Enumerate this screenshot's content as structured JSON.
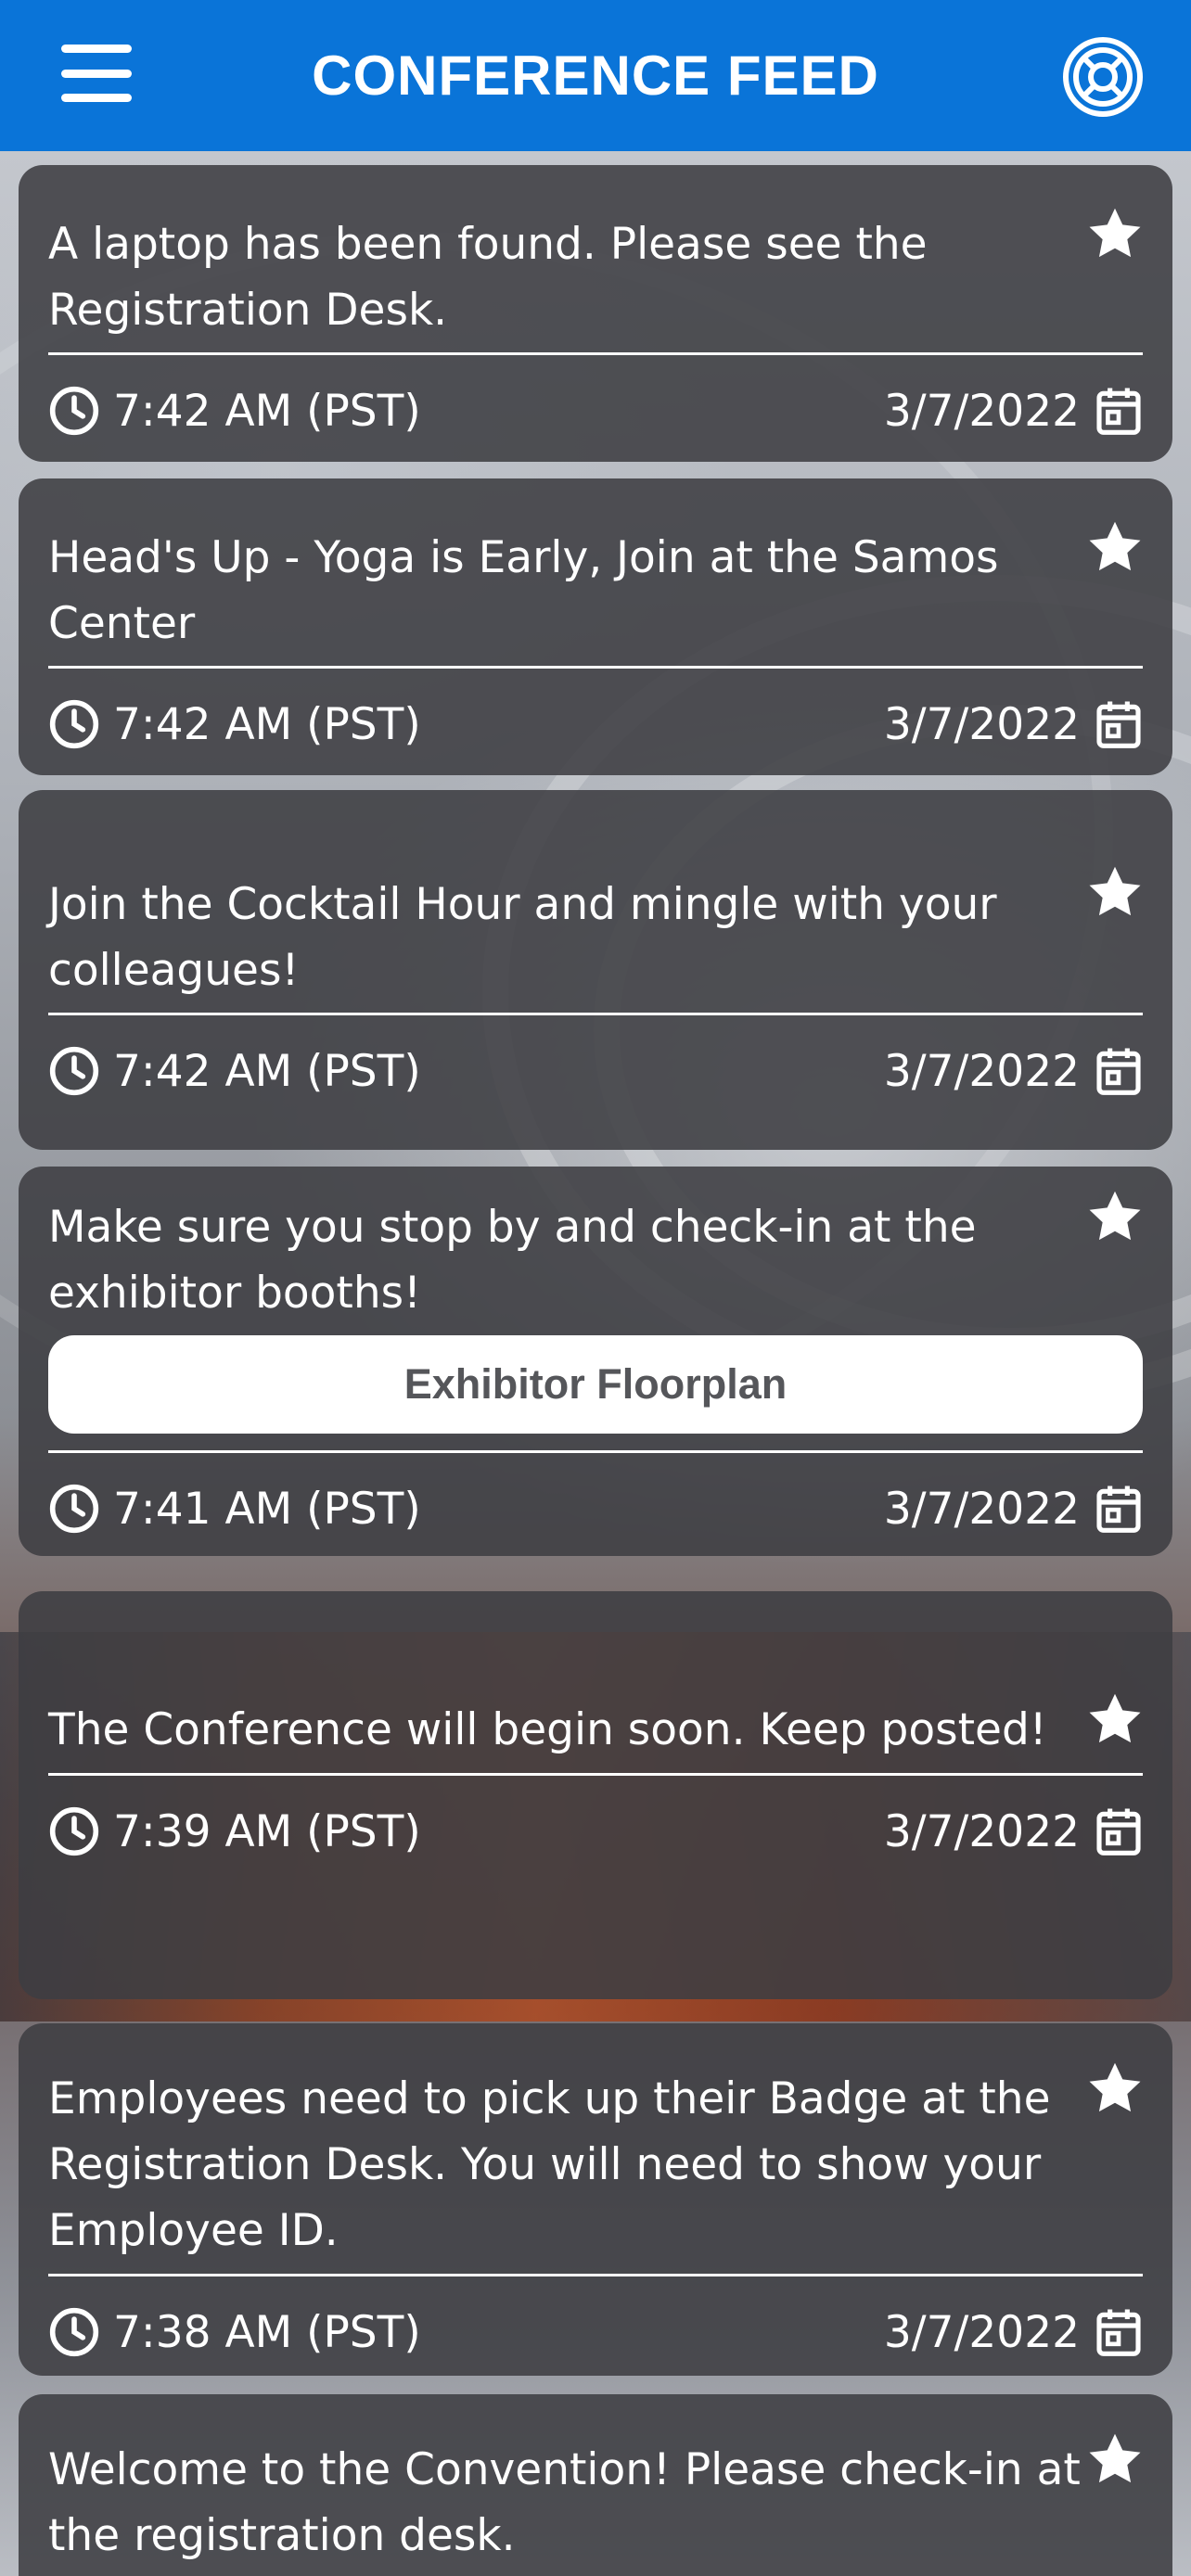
{
  "header": {
    "title": "CONFERENCE FEED"
  },
  "icons": {
    "menu": "hamburger-menu-icon",
    "help": "lifebuoy-icon",
    "favorite": "star-icon",
    "time": "clock-icon",
    "date": "calendar-icon"
  },
  "colors": {
    "header_bg": "#0a74d8",
    "card_bg": "#3e3e42",
    "text": "#ffffff",
    "button_bg": "#ffffff",
    "button_text": "#55565a"
  },
  "feed": [
    {
      "message": "A laptop has been found. Please see the Registration Desk.",
      "time": "7:42 AM (PST)",
      "date": "3/7/2022"
    },
    {
      "message": "Head's Up - Yoga is Early, Join at the Samos Center",
      "time": "7:42 AM (PST)",
      "date": "3/7/2022"
    },
    {
      "message": "Join the Cocktail Hour and mingle with your colleagues!",
      "time": "7:42 AM (PST)",
      "date": "3/7/2022"
    },
    {
      "message": "Make sure you stop by and check-in at the exhibitor booths!",
      "button_label": "Exhibitor Floorplan",
      "time": "7:41 AM (PST)",
      "date": "3/7/2022"
    },
    {
      "message": "The Conference will begin soon. Keep posted!",
      "time": "7:39 AM (PST)",
      "date": "3/7/2022"
    },
    {
      "message": "Employees need to pick up their Badge at the Registration Desk. You will need to show your Employee ID.",
      "time": "7:38 AM (PST)",
      "date": "3/7/2022"
    },
    {
      "message": "Welcome to the Convention! Please check-in at the registration desk.",
      "time": "",
      "date": ""
    }
  ]
}
